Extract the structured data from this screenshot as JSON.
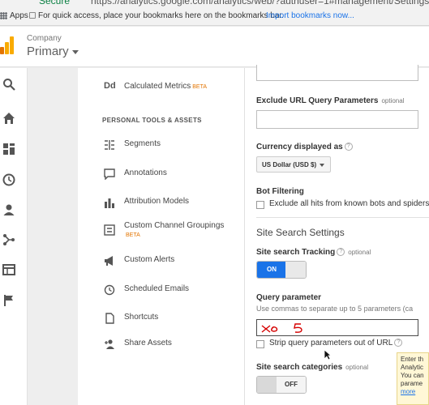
{
  "browser": {
    "secure_label": "Secure",
    "url": "https://analytics.google.com/analytics/web/?authuser=1#management/Settings/a",
    "bookmarks": {
      "apps_label": "Apps",
      "hint": "For quick access, place your bookmarks here on the bookmarks bar.",
      "import_link": "Import bookmarks now..."
    }
  },
  "header": {
    "company": "Company",
    "property": "Primary"
  },
  "rail": {
    "icons": [
      "search-icon",
      "home-icon",
      "dashboard-icon",
      "clock-icon",
      "person-icon",
      "share-icon",
      "table-icon",
      "flag-icon"
    ]
  },
  "middle_nav": {
    "top_item": {
      "icon": "Dd",
      "label": "Calculated Metrics",
      "badge": "BETA"
    },
    "section_label": "PERSONAL TOOLS & ASSETS",
    "items": [
      {
        "label": "Segments",
        "icon": "segments-icon"
      },
      {
        "label": "Annotations",
        "icon": "annotations-icon"
      },
      {
        "label": "Attribution Models",
        "icon": "bar-chart-icon"
      },
      {
        "label": "Custom Channel Groupings",
        "badge": "BETA",
        "icon": "channel-groupings-icon"
      },
      {
        "label": "Custom Alerts",
        "icon": "megaphone-icon"
      },
      {
        "label": "Scheduled Emails",
        "icon": "clock-icon"
      },
      {
        "label": "Shortcuts",
        "icon": "document-icon"
      },
      {
        "label": "Share Assets",
        "icon": "add-person-icon"
      }
    ]
  },
  "settings": {
    "exclude_url": {
      "title": "Exclude URL Query Parameters",
      "optional": "optional",
      "value": ""
    },
    "currency": {
      "title": "Currency displayed as",
      "help": "?",
      "value": "US Dollar (USD $)"
    },
    "bot_filtering": {
      "title": "Bot Filtering",
      "checkbox_label": "Exclude all hits from known bots and spiders",
      "checked": false
    },
    "site_search_heading": "Site Search Settings",
    "site_search_tracking": {
      "title": "Site search Tracking",
      "help": "?",
      "optional": "optional",
      "state": "ON"
    },
    "query_parameter": {
      "title": "Query parameter",
      "hint": "Use commas to separate up to 5 parameters (ca",
      "value": "",
      "strip_label": "Strip query parameters out of URL",
      "strip_help": "?",
      "strip_checked": false
    },
    "site_search_categories": {
      "title": "Site search categories",
      "optional": "optional",
      "state": "OFF"
    }
  },
  "tooltip": {
    "lines": [
      "Enter th",
      "Analytic",
      "You can",
      "parame"
    ],
    "more_link": "more"
  },
  "colors": {
    "accent": "#1a73e8",
    "logo_orange": "#f9ab00",
    "logo_dark": "#e37400",
    "beta": "#e37400",
    "annotation_red": "#d50000"
  }
}
